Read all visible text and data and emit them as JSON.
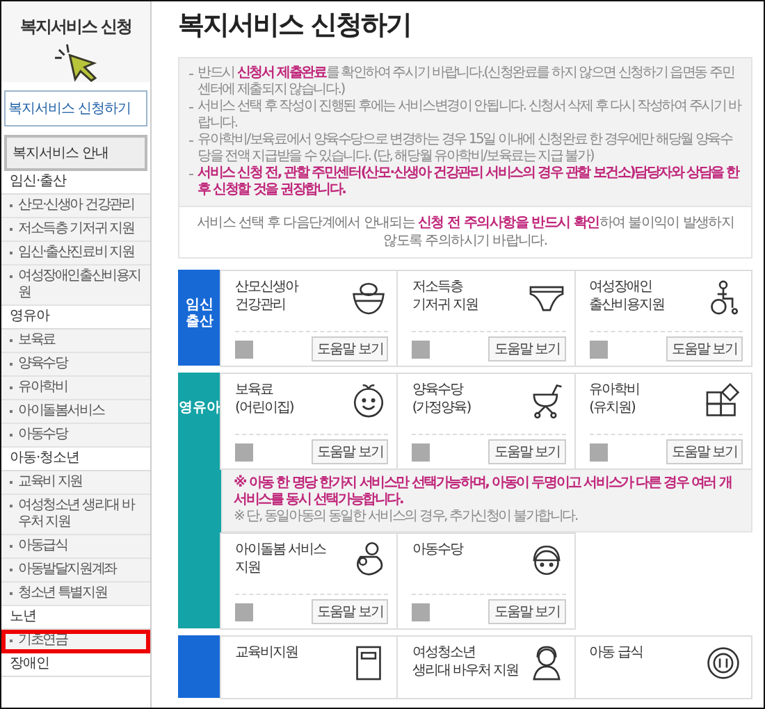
{
  "sidebar": {
    "title": "복지서비스 신청",
    "apply_button": "복지서비스 신청하기",
    "guide_header": "복지서비스 안내",
    "categories": [
      {
        "label": "임신·출산",
        "items": [
          {
            "label": "산모·신생아 건강관리",
            "selected": false
          },
          {
            "label": "저소득층 기저귀 지원",
            "selected": false
          },
          {
            "label": "임신·출산진료비 지원",
            "selected": false
          },
          {
            "label": "여성장애인출산비용지원",
            "selected": false
          }
        ]
      },
      {
        "label": "영유아",
        "items": [
          {
            "label": "보육료",
            "selected": false
          },
          {
            "label": "양육수당",
            "selected": false
          },
          {
            "label": "유아학비",
            "selected": false
          },
          {
            "label": "아이돌봄서비스",
            "selected": false
          },
          {
            "label": "아동수당",
            "selected": false
          }
        ]
      },
      {
        "label": "아동·청소년",
        "items": [
          {
            "label": "교육비 지원",
            "selected": false
          },
          {
            "label": "여성청소년 생리대 바우처 지원",
            "selected": false
          },
          {
            "label": "아동급식",
            "selected": false
          },
          {
            "label": "아동발달지원계좌",
            "selected": false
          },
          {
            "label": "청소년 특별지원",
            "selected": false
          }
        ]
      },
      {
        "label": "노년",
        "items": [
          {
            "label": "기초연금",
            "selected": true
          }
        ]
      },
      {
        "label": "장애인"
      }
    ]
  },
  "main": {
    "title": "복지서비스 신청하기",
    "notices": [
      {
        "kind": "normal",
        "text": "반드시 **신청서 제출완료**를 확인하여 주시기 바랍니다.(신청완료를 하지 않으면 신청하기 읍면동 주민센터에 제출되지 않습니다.)"
      },
      {
        "kind": "normal",
        "text": "서비스 선택 후 작성이 진행된 후에는 서비스변경이 안됩니다. 신청서 삭제 후 다시 작성하여 주시기 바랍니다."
      },
      {
        "kind": "normal",
        "text": "유아학비/보육료에서 양육수당으로 변경하는 경우 15일 이내에 신청완료 한 경우에만 해당월 양육수당을 전액 지급받을 수 있습니다. (단, 해당월 유아학비/보육료는 지급 불가)"
      },
      {
        "kind": "emphasis",
        "text": "서비스 신청 전, 관할 주민센터(산모·신생아 건강관리 서비스의 경우 관할 보건소)담당자와 상담을 한 후 신청할 것을 권장합니다."
      }
    ],
    "caution": "서비스 선택 후 다음단계에서 안내되는 **신청 전 주의사항을 반드시 확인**하여 불이익이 발생하지 않도록 주의하시기 바랍니다.",
    "groups": [
      {
        "label": "임신\n출산",
        "color": "#1769d6",
        "blocks": [
          {
            "kind": "cards",
            "cards": [
              {
                "title": "산모신생아\n건강관리",
                "checked": false,
                "help": "도움말 보기"
              },
              {
                "title": "저소득층\n기저귀 지원",
                "checked": false,
                "help": "도움말 보기"
              },
              {
                "title": "여성장애인\n출산비용지원",
                "checked": false,
                "help": "도움말 보기"
              }
            ]
          }
        ]
      },
      {
        "label": "영유아",
        "color": "#14a3a6",
        "blocks": [
          {
            "kind": "cards",
            "cards": [
              {
                "title": "보육료\n(어린이집)",
                "checked": false,
                "help": "도움말 보기"
              },
              {
                "title": "양육수당\n(가정양육)",
                "checked": false,
                "help": "도움말 보기"
              },
              {
                "title": "유아학비\n(유치원)",
                "checked": false,
                "help": "도움말 보기"
              }
            ]
          },
          {
            "kind": "note",
            "lines": [
              {
                "kind": "emphasis",
                "text": "※ 아동 한 명당 한가지 서비스만 선택가능하며, 아동이 두명이고 서비스가 다른 경우 여러 개 서비스를 동시 선택가능합니다."
              },
              {
                "kind": "normal",
                "text": "※ 단, 동일아동의 동일한 서비스의 경우, 추가신청이 불가합니다."
              }
            ]
          },
          {
            "kind": "cards",
            "cards": [
              {
                "title": "아이돌봄 서비스\n지원",
                "checked": false,
                "help": "도움말 보기"
              },
              {
                "title": "아동수당",
                "checked": false,
                "help": "도움말 보기"
              }
            ]
          }
        ]
      },
      {
        "color": "#1769d6",
        "blocks": [
          {
            "kind": "cards",
            "cards": [
              {
                "title": "교육비지원"
              },
              {
                "title": "여성청소년\n생리대 바우처 지원"
              },
              {
                "title": "아동 급식"
              }
            ]
          }
        ]
      }
    ]
  }
}
